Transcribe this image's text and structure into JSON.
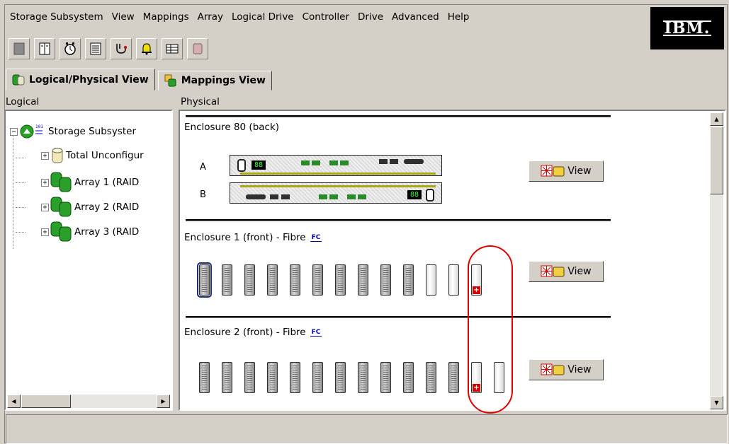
{
  "menu": [
    "Storage Subsystem",
    "View",
    "Mappings",
    "Array",
    "Logical Drive",
    "Controller",
    "Drive",
    "Advanced",
    "Help"
  ],
  "logo_text": "IBM.",
  "toolbar_icons": [
    "create-storage-icon",
    "properties-icon",
    "clock-icon",
    "list-icon",
    "stethoscope-icon",
    "bell-alert-icon",
    "table-icon",
    "help-icon"
  ],
  "tabs": [
    {
      "label": "Logical/Physical View",
      "active": true
    },
    {
      "label": "Mappings View",
      "active": false
    }
  ],
  "left_pane": {
    "label": "Logical",
    "tree": [
      {
        "label": "Storage Subsyster",
        "expander": "⊟"
      },
      {
        "label": "Total Unconfigur",
        "expander": "+"
      },
      {
        "label": "Array 1 (RAID",
        "expander": "+"
      },
      {
        "label": "Array 2 (RAID",
        "expander": "+"
      },
      {
        "label": "Array 3 (RAID",
        "expander": "+"
      }
    ]
  },
  "right_pane": {
    "label": "Physical",
    "enclosure_80": {
      "title": "Enclosure 80 (back)",
      "slots": [
        "A",
        "B"
      ],
      "led_a": "88",
      "led_b": "88",
      "view_label": "View"
    },
    "enclosure_1": {
      "title": "Enclosure 1 (front) - Fibre",
      "badge": "FC",
      "view_label": "View",
      "drives": [
        "selected",
        "full",
        "full",
        "full",
        "full",
        "full",
        "full",
        "full",
        "full",
        "full",
        "empty",
        "empty",
        "hotspare"
      ]
    },
    "enclosure_2": {
      "title": "Enclosure 2 (front) - Fibre",
      "badge": "FC",
      "view_label": "View",
      "drives": [
        "full",
        "full",
        "full",
        "full",
        "full",
        "full",
        "full",
        "full",
        "full",
        "full",
        "full",
        "full",
        "hotspare",
        "empty"
      ]
    }
  },
  "colors": {
    "highlight": "#e00000",
    "accent_green": "#2a9a2a"
  }
}
